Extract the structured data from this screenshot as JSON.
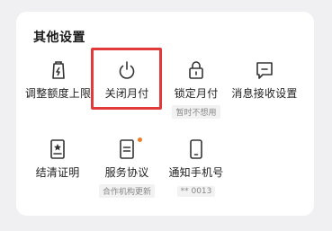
{
  "section_title": "其他设置",
  "items": [
    {
      "label": "调整额度上限",
      "icon": "lightning-bag-icon"
    },
    {
      "label": "关闭月付",
      "icon": "power-icon"
    },
    {
      "label": "锁定月付",
      "icon": "lock-icon",
      "tag": "暂时不想用"
    },
    {
      "label": "消息接收设置",
      "icon": "message-icon"
    },
    {
      "label": "结清证明",
      "icon": "certificate-icon"
    },
    {
      "label": "服务协议",
      "icon": "document-icon",
      "tag": "合作机构更新",
      "badge": true
    },
    {
      "label": "通知手机号",
      "icon": "phone-icon",
      "tag": "** 0013"
    }
  ],
  "colors": {
    "highlight": "#e03a3a",
    "badge_dot": "#f07a2a",
    "icon_stroke": "#333333"
  }
}
